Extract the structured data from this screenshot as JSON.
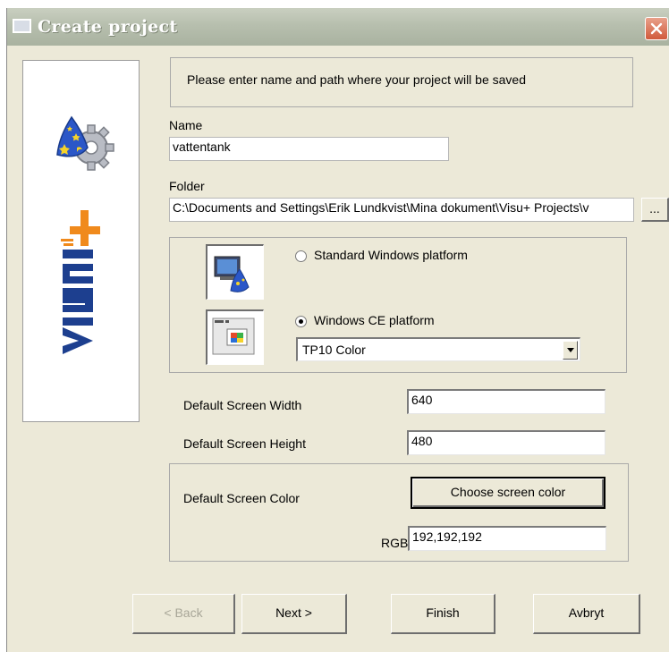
{
  "window": {
    "title": "Create project"
  },
  "header": {
    "message": "Please enter name and path where your project will be saved"
  },
  "name": {
    "label": "Name",
    "value": "vattentank"
  },
  "folder": {
    "label": "Folder",
    "value": "C:\\Documents and Settings\\Erik Lundkvist\\Mina dokument\\Visu+ Projects\\v",
    "browse_label": "..."
  },
  "platform": {
    "standard_label": "Standard Windows platform",
    "ce_label": "Windows CE platform",
    "selected": "Windows CE platform",
    "ce_model": "TP10 Color"
  },
  "screen": {
    "width_label": "Default Screen Width",
    "width_value": "640",
    "height_label": "Default Screen Height",
    "height_value": "480",
    "color_label": "Default Screen Color",
    "choose_color_label": "Choose screen color",
    "rgb_label": "RGB",
    "rgb_value": "192,192,192"
  },
  "buttons": {
    "back": "< Back",
    "next": "Next >",
    "finish": "Finish",
    "cancel": "Avbryt"
  },
  "colors": {
    "title_bar": "#b7bfae",
    "dialog_bg": "#ece9d8",
    "close_button": "#d15a3b",
    "logo_orange": "#f08a1c",
    "logo_blue": "#1d3f8f"
  },
  "icons": [
    "window-icon",
    "close-icon",
    "wizard-gear-icon",
    "visu-plus-logo",
    "standard-platform-icon",
    "ce-platform-icon",
    "dropdown-arrow-icon"
  ]
}
